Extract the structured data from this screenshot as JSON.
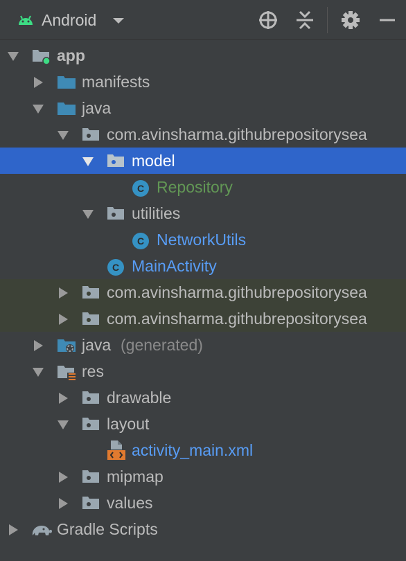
{
  "toolbar": {
    "title": "Android",
    "icons": [
      "android-icon",
      "chevron-down-icon",
      "locate-icon",
      "collapse-all-icon",
      "gear-icon",
      "minimize-icon"
    ]
  },
  "tree": {
    "app": "app",
    "manifests": "manifests",
    "java": "java",
    "package_main": "com.avinsharma.githubrepositorysea",
    "model": "model",
    "repository": "Repository",
    "utilities": "utilities",
    "network_utils": "NetworkUtils",
    "main_activity": "MainActivity",
    "package_test": "com.avinsharma.githubrepositorysea",
    "package_android_test": "com.avinsharma.githubrepositorysea",
    "java_generated": "java",
    "generated_suffix": "(generated)",
    "res": "res",
    "drawable": "drawable",
    "layout": "layout",
    "activity_main": "activity_main.xml",
    "mipmap": "mipmap",
    "values": "values",
    "gradle_scripts": "Gradle Scripts"
  },
  "colors": {
    "background": "#3c3f41",
    "selection": "#2f65ca",
    "shaded_row": "#3d4237",
    "class_green": "#629755",
    "class_blue": "#589df6",
    "class_icon": "#3592c4",
    "folder_blue": "#3f8ab5",
    "folder_gray": "#9aa7b0",
    "xml_orange": "#e07a2f"
  }
}
